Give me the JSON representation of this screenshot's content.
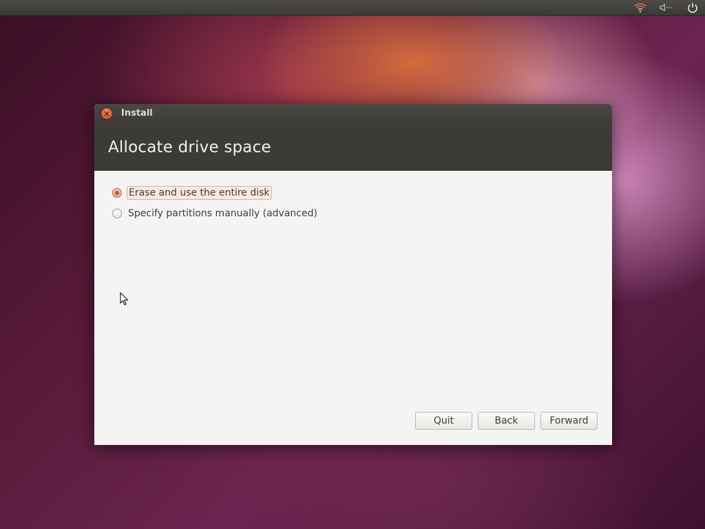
{
  "window": {
    "title": "Install",
    "page_title": "Allocate drive space"
  },
  "options": [
    {
      "label": "Erase and use the entire disk",
      "selected": true
    },
    {
      "label": "Specify partitions manually (advanced)",
      "selected": false
    }
  ],
  "buttons": {
    "quit": "Quit",
    "back": "Back",
    "forward": "Forward"
  },
  "panel": {
    "icons": [
      "network-wireless-icon",
      "volume-icon",
      "power-icon"
    ]
  },
  "colors": {
    "accent": "#e05a2f",
    "header_bg": "#3c3b37",
    "content_bg": "#f4f4f3"
  }
}
